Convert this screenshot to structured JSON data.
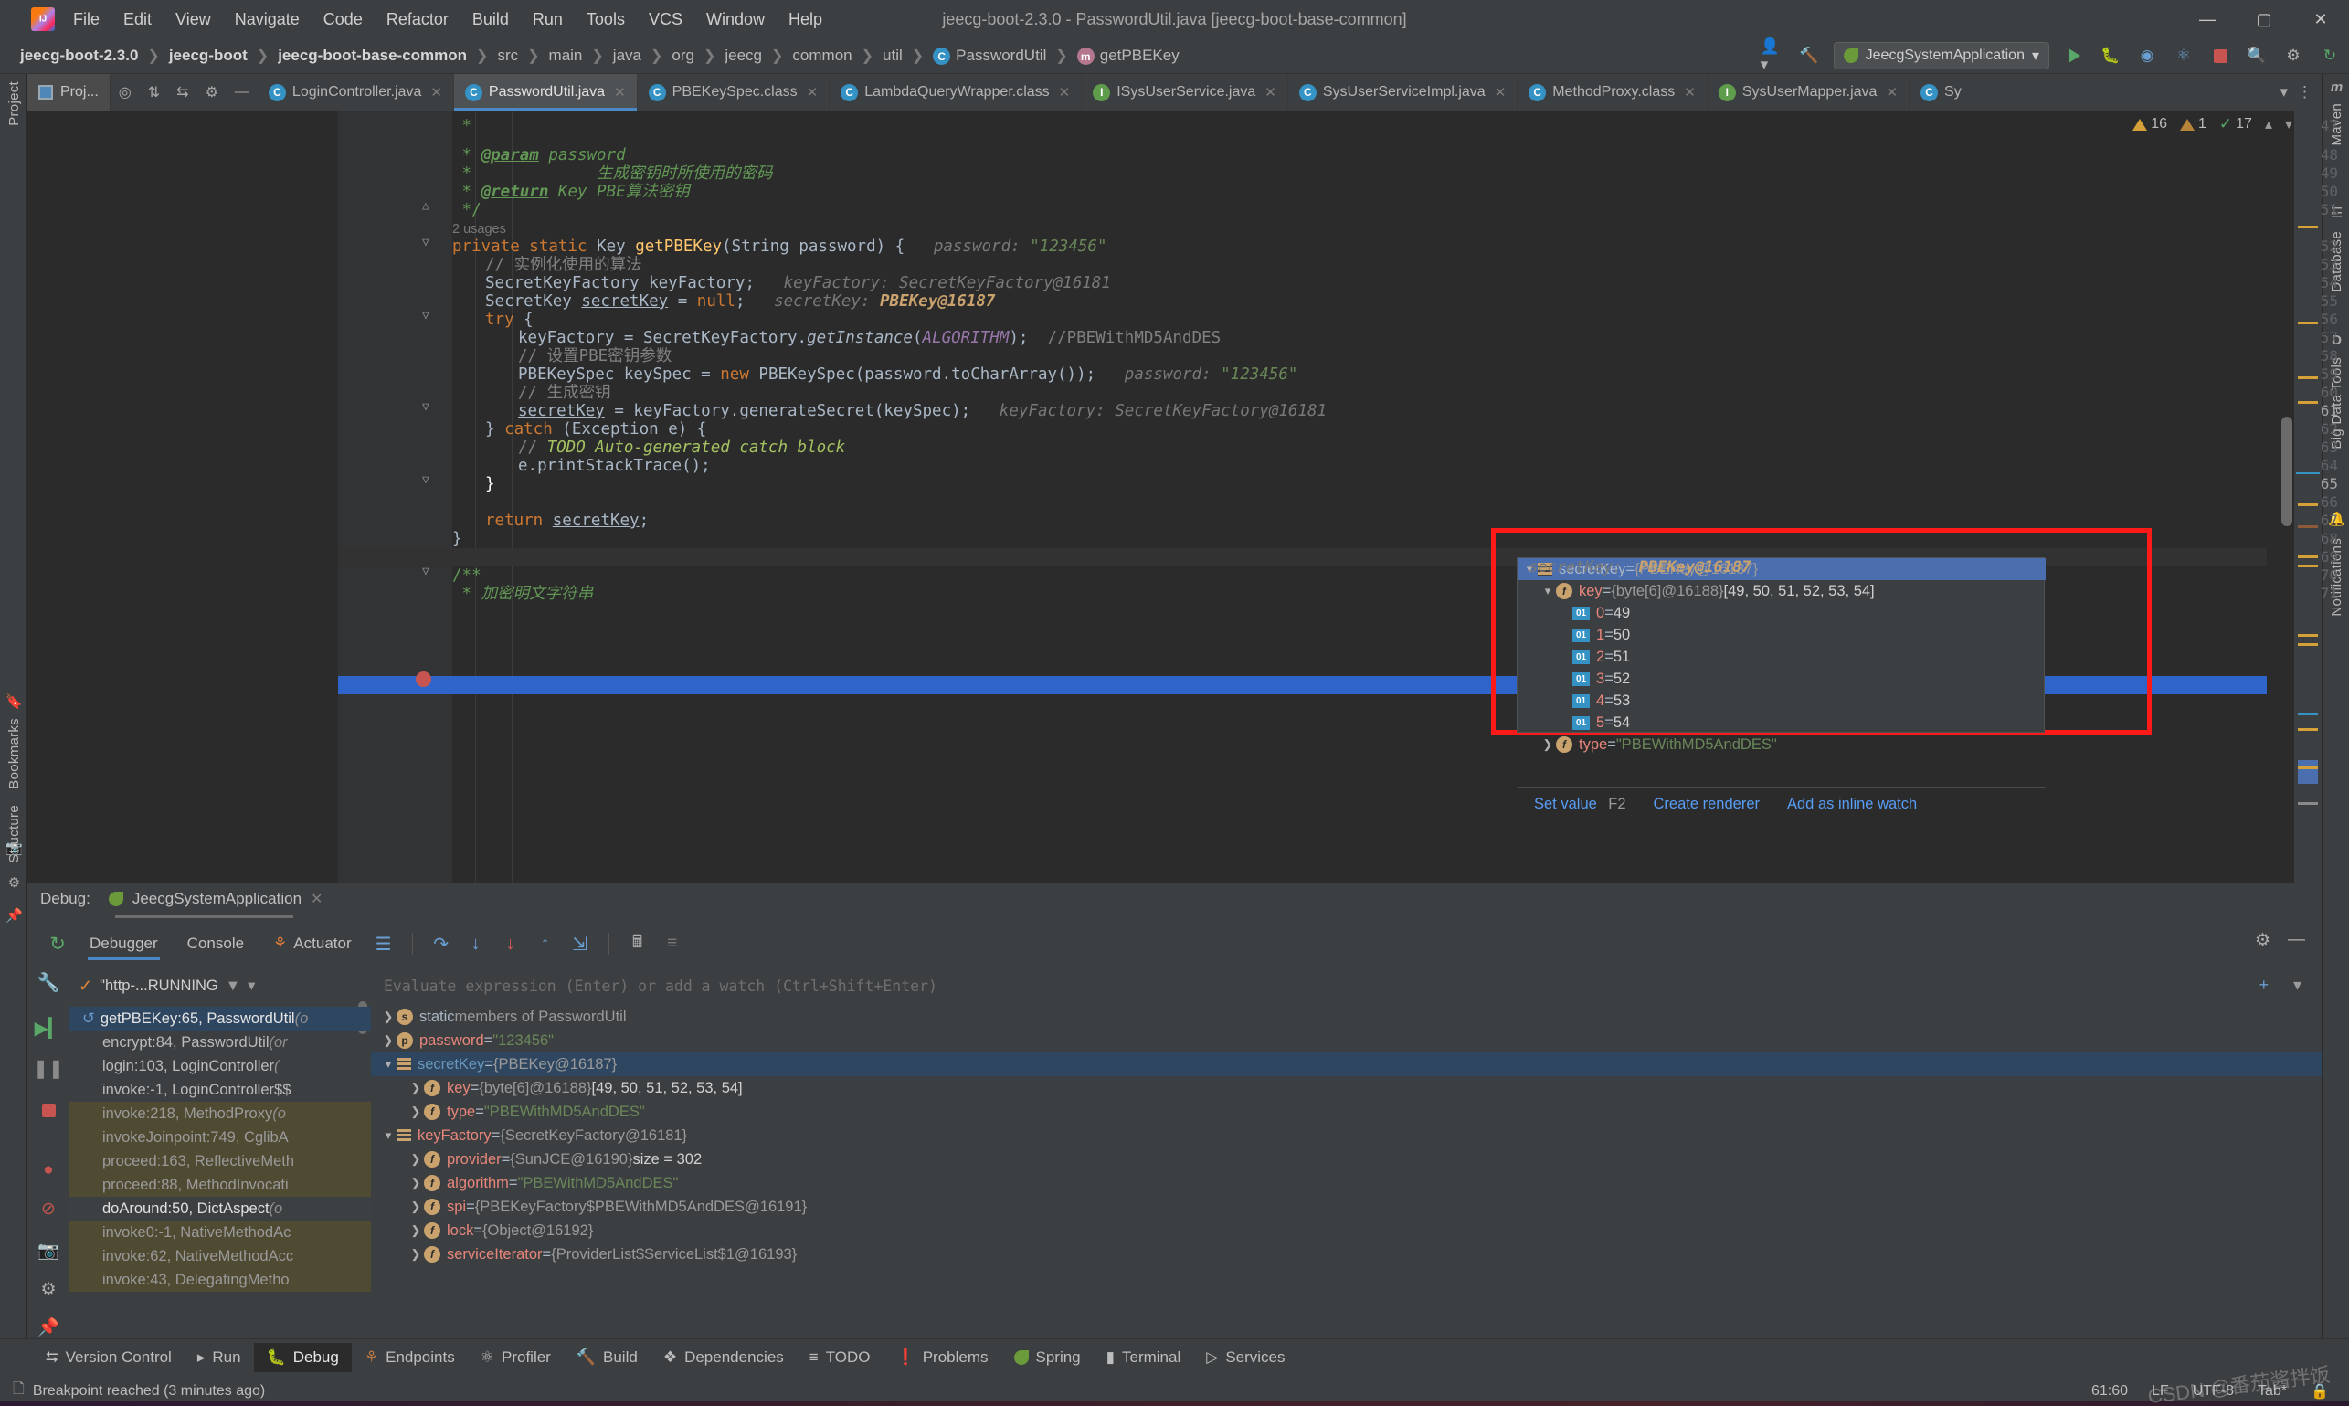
{
  "window": {
    "title": "jeecg-boot-2.3.0 - PasswordUtil.java [jeecg-boot-base-common]",
    "minimize": "—",
    "maximize": "▢",
    "close": "✕"
  },
  "menu": [
    "File",
    "Edit",
    "View",
    "Navigate",
    "Code",
    "Refactor",
    "Build",
    "Run",
    "Tools",
    "VCS",
    "Window",
    "Help"
  ],
  "breadcrumbs": [
    {
      "label": "jeecg-boot-2.3.0",
      "bold": true,
      "icon": ""
    },
    {
      "label": "jeecg-boot",
      "bold": true,
      "icon": ""
    },
    {
      "label": "jeecg-boot-base-common",
      "bold": true,
      "icon": ""
    },
    {
      "label": "src",
      "bold": false,
      "icon": ""
    },
    {
      "label": "main",
      "bold": false,
      "icon": ""
    },
    {
      "label": "java",
      "bold": false,
      "icon": ""
    },
    {
      "label": "org",
      "bold": false,
      "icon": ""
    },
    {
      "label": "jeecg",
      "bold": false,
      "icon": ""
    },
    {
      "label": "common",
      "bold": false,
      "icon": ""
    },
    {
      "label": "util",
      "bold": false,
      "icon": ""
    },
    {
      "label": "PasswordUtil",
      "bold": false,
      "icon": "class-icon"
    },
    {
      "label": "getPBEKey",
      "bold": false,
      "icon": "method-icon"
    }
  ],
  "nav_right": {
    "run_config": "JeecgSystemApplication",
    "icons": [
      "user-icon",
      "hammer-icon",
      "run-icon",
      "debug-icon",
      "coverage-icon",
      "profiler-icon",
      "stop-icon",
      "search-icon",
      "settings-icon",
      "updates-icon"
    ]
  },
  "project_button": "Proj...",
  "editor_tabs": [
    {
      "label": "LoginController.java",
      "icon": "C",
      "kind": "class",
      "active": false
    },
    {
      "label": "PasswordUtil.java",
      "icon": "C",
      "kind": "class",
      "active": true
    },
    {
      "label": "PBEKeySpec.class",
      "icon": "C",
      "kind": "class",
      "active": false
    },
    {
      "label": "LambdaQueryWrapper.class",
      "icon": "C",
      "kind": "class",
      "active": false
    },
    {
      "label": "ISysUserService.java",
      "icon": "I",
      "kind": "interface",
      "active": false
    },
    {
      "label": "SysUserServiceImpl.java",
      "icon": "C",
      "kind": "class",
      "active": false
    },
    {
      "label": "MethodProxy.class",
      "icon": "C",
      "kind": "class",
      "active": false
    },
    {
      "label": "SysUserMapper.java",
      "icon": "I",
      "kind": "interface",
      "active": false
    },
    {
      "label": "Sy",
      "icon": "C",
      "kind": "class",
      "active": false
    }
  ],
  "inspections": {
    "warnings": "16",
    "weak_warnings": "1",
    "typos": "17",
    "warning_icon": "warning-triangle-icon",
    "ok_icon": "checkmark-icon"
  },
  "code": {
    "usages_hint": "2 usages",
    "lines": [
      {
        "n": "47",
        "text": "     *"
      },
      {
        "n": "48",
        "text": "     * @param password"
      },
      {
        "n": "49",
        "text": "     *             生成密钥时所使用的密码"
      },
      {
        "n": "50",
        "text": "     * @return Key PBE算法密钥"
      },
      {
        "n": "51",
        "text": "     */"
      },
      {
        "n": "52",
        "text": "    private static Key getPBEKey(String password) {   password: \"123456\""
      },
      {
        "n": "53",
        "text": "        // 实例化使用的算法"
      },
      {
        "n": "54",
        "text": "        SecretKeyFactory keyFactory;   keyFactory: SecretKeyFactory@16181"
      },
      {
        "n": "55",
        "text": "        SecretKey secretKey = null;   secretKey: PBEKey@16187"
      },
      {
        "n": "56",
        "text": "        try {"
      },
      {
        "n": "57",
        "text": "            keyFactory = SecretKeyFactory.getInstance(ALGORITHM);  //PBEWithMD5AndDES"
      },
      {
        "n": "58",
        "text": "            // 设置PBE密钥参数"
      },
      {
        "n": "59",
        "text": "            PBEKeySpec keySpec = new PBEKeySpec(password.toCharArray());   password: \"123456\""
      },
      {
        "n": "60",
        "text": "            // 生成密钥"
      },
      {
        "n": "61",
        "text": "            secretKey = keyFactory.generateSecret(keySpec);   keyFactory: SecretKeyFactory@16181"
      },
      {
        "n": "62",
        "text": "        } catch (Exception e) {"
      },
      {
        "n": "63",
        "text": "            // TODO Auto-generated catch block"
      },
      {
        "n": "64",
        "text": "            e.printStackTrace();"
      },
      {
        "n": "65",
        "text": "        }"
      },
      {
        "n": "66",
        "text": ""
      },
      {
        "n": "67",
        "text": "        return secretKey;"
      },
      {
        "n": "68",
        "text": "    }"
      },
      {
        "n": "69",
        "text": ""
      },
      {
        "n": "70",
        "text": "    /**"
      },
      {
        "n": "71",
        "text": "     * 加密明文字符串"
      }
    ]
  },
  "popup": {
    "expression_label": "secretKey:",
    "expression_value": "PBEKey@16187",
    "rows": [
      {
        "indent": 0,
        "chev": "v",
        "icon": "object-icon",
        "name": "secretKey",
        "eq": " = ",
        "value": "{PBEKey@16187}",
        "selected": true,
        "value_kind": "ref"
      },
      {
        "indent": 1,
        "chev": "v",
        "icon": "field-icon",
        "name": "key",
        "eq": " = ",
        "value": "{byte[6]@16188}",
        "extra": " [49, 50, 51, 52, 53, 54]",
        "selected": false,
        "value_kind": "ref"
      },
      {
        "indent": 2,
        "chev": "",
        "icon": "byte-icon",
        "name": "0",
        "eq": " = ",
        "value": "49",
        "selected": false,
        "value_kind": "num"
      },
      {
        "indent": 2,
        "chev": "",
        "icon": "byte-icon",
        "name": "1",
        "eq": " = ",
        "value": "50",
        "selected": false,
        "value_kind": "num"
      },
      {
        "indent": 2,
        "chev": "",
        "icon": "byte-icon",
        "name": "2",
        "eq": " = ",
        "value": "51",
        "selected": false,
        "value_kind": "num"
      },
      {
        "indent": 2,
        "chev": "",
        "icon": "byte-icon",
        "name": "3",
        "eq": " = ",
        "value": "52",
        "selected": false,
        "value_kind": "num"
      },
      {
        "indent": 2,
        "chev": "",
        "icon": "byte-icon",
        "name": "4",
        "eq": " = ",
        "value": "53",
        "selected": false,
        "value_kind": "num"
      },
      {
        "indent": 2,
        "chev": "",
        "icon": "byte-icon",
        "name": "5",
        "eq": " = ",
        "value": "54",
        "selected": false,
        "value_kind": "num"
      },
      {
        "indent": 1,
        "chev": ">",
        "icon": "field-icon",
        "name": "type",
        "eq": " = ",
        "value": "\"PBEWithMD5AndDES\"",
        "selected": false,
        "value_kind": "str"
      }
    ],
    "actions": [
      {
        "label": "Set value",
        "key": "F2"
      },
      {
        "label": "Create renderer",
        "key": ""
      },
      {
        "label": "Add as inline watch",
        "key": ""
      }
    ]
  },
  "debug_window": {
    "title_label": "Debug:",
    "session": "JeecgSystemApplication",
    "tabs": [
      {
        "label": "Debugger",
        "active": true,
        "icon": ""
      },
      {
        "label": "Console",
        "active": false,
        "icon": ""
      },
      {
        "label": "Actuator",
        "active": false,
        "icon": "actuator-icon"
      }
    ],
    "thread_selector": "\"http-...RUNNING",
    "frames": [
      {
        "label": "getPBEKey:65, PasswordUtil",
        "suffix": " (o",
        "state": "selected"
      },
      {
        "label": "encrypt:84, PasswordUtil",
        "suffix": " (or",
        "state": "normal"
      },
      {
        "label": "login:103, LoginController",
        "suffix": " (",
        "state": "normal"
      },
      {
        "label": "invoke:-1, LoginController$$",
        "suffix": "",
        "state": "normal"
      },
      {
        "label": "invoke:218, MethodProxy",
        "suffix": " (o",
        "state": "lib"
      },
      {
        "label": "invokeJoinpoint:749, CglibA",
        "suffix": "",
        "state": "lib"
      },
      {
        "label": "proceed:163, ReflectiveMeth",
        "suffix": "",
        "state": "lib"
      },
      {
        "label": "proceed:88, MethodInvocati",
        "suffix": "",
        "state": "lib"
      },
      {
        "label": "doAround:50, DictAspect",
        "suffix": " (o",
        "state": "libsel"
      },
      {
        "label": "invoke0:-1, NativeMethodAc",
        "suffix": "",
        "state": "lib"
      },
      {
        "label": "invoke:62, NativeMethodAcc",
        "suffix": "",
        "state": "lib"
      },
      {
        "label": "invoke:43, DelegatingMetho",
        "suffix": "",
        "state": "lib"
      }
    ],
    "evaluate_placeholder": "Evaluate expression (Enter) or add a watch (Ctrl+Shift+Enter)",
    "variables": [
      {
        "indent": 0,
        "chev": ">",
        "icon": "static-icon",
        "name": "static",
        "name_kind": "plain",
        "rest": " members of PasswordUtil",
        "eq": "",
        "value": "",
        "value_kind": "",
        "selected": false
      },
      {
        "indent": 0,
        "chev": ">",
        "icon": "param-icon",
        "name": "password",
        "name_kind": "red",
        "eq": " = ",
        "value": "\"123456\"",
        "value_kind": "str",
        "selected": false
      },
      {
        "indent": 0,
        "chev": "v",
        "icon": "object-icon",
        "name": "secretKey",
        "name_kind": "blue",
        "eq": " = ",
        "value": "{PBEKey@16187}",
        "value_kind": "ref",
        "selected": true
      },
      {
        "indent": 1,
        "chev": ">",
        "icon": "field-icon",
        "name": "key",
        "name_kind": "red",
        "eq": " = ",
        "value": "{byte[6]@16188}",
        "extra": " [49, 50, 51, 52, 53, 54]",
        "value_kind": "ref",
        "selected": false
      },
      {
        "indent": 1,
        "chev": ">",
        "icon": "field-icon",
        "name": "type",
        "name_kind": "red",
        "eq": " = ",
        "value": "\"PBEWithMD5AndDES\"",
        "value_kind": "str",
        "selected": false
      },
      {
        "indent": 0,
        "chev": "v",
        "icon": "object-icon",
        "name": "keyFactory",
        "name_kind": "red",
        "eq": " = ",
        "value": "{SecretKeyFactory@16181}",
        "value_kind": "ref",
        "selected": false
      },
      {
        "indent": 1,
        "chev": ">",
        "icon": "field-icon",
        "name": "provider",
        "name_kind": "red",
        "eq": " = ",
        "value": "{SunJCE@16190}",
        "extra": "  size = 302",
        "value_kind": "ref",
        "selected": false
      },
      {
        "indent": 1,
        "chev": ">",
        "icon": "field-icon",
        "name": "algorithm",
        "name_kind": "red",
        "eq": " = ",
        "value": "\"PBEWithMD5AndDES\"",
        "value_kind": "str",
        "selected": false
      },
      {
        "indent": 1,
        "chev": ">",
        "icon": "field-icon",
        "name": "spi",
        "name_kind": "red",
        "eq": " = ",
        "value": "{PBEKeyFactory$PBEWithMD5AndDES@16191}",
        "value_kind": "ref",
        "selected": false
      },
      {
        "indent": 1,
        "chev": ">",
        "icon": "field-icon",
        "name": "lock",
        "name_kind": "red",
        "eq": " = ",
        "value": "{Object@16192}",
        "value_kind": "ref",
        "selected": false
      },
      {
        "indent": 1,
        "chev": ">",
        "icon": "field-icon",
        "name": "serviceIterator",
        "name_kind": "red",
        "eq": " = ",
        "value": "{ProviderList$ServiceList$1@16193}",
        "value_kind": "ref",
        "selected": false
      }
    ]
  },
  "bottom_tools": [
    {
      "label": "Version Control",
      "icon": "branch-icon",
      "active": false
    },
    {
      "label": "Run",
      "icon": "play-icon",
      "active": false
    },
    {
      "label": "Debug",
      "icon": "bug-icon",
      "active": true
    },
    {
      "label": "Endpoints",
      "icon": "endpoints-icon",
      "active": false
    },
    {
      "label": "Profiler",
      "icon": "profiler-icon",
      "active": false
    },
    {
      "label": "Build",
      "icon": "hammer-icon",
      "active": false
    },
    {
      "label": "Dependencies",
      "icon": "layers-icon",
      "active": false
    },
    {
      "label": "TODO",
      "icon": "list-icon",
      "active": false
    },
    {
      "label": "Problems",
      "icon": "exclamation-icon",
      "active": false
    },
    {
      "label": "Spring",
      "icon": "leaf-icon",
      "active": false
    },
    {
      "label": "Terminal",
      "icon": "terminal-icon",
      "active": false
    },
    {
      "label": "Services",
      "icon": "services-icon",
      "active": false
    }
  ],
  "status": {
    "message": "Breakpoint reached (3 minutes ago)",
    "caret": "61:60",
    "line_sep": "LF",
    "encoding": "UTF-8",
    "indent": "Tab*",
    "watermark": "CSDN @番茄酱拌饭"
  },
  "left_strip": [
    "Project",
    "Bookmarks",
    "Structure"
  ],
  "right_strip": [
    "Maven",
    "Database",
    "Big Data Tools",
    "Notifications"
  ],
  "colors": {
    "accent": "#4a88c7",
    "selection": "#2f65ca",
    "popup_outline": "#ff1a1a",
    "keyword": "#cc7832",
    "string": "#6a8759",
    "comment": "#808080",
    "javadoc": "#629755",
    "method": "#ffc66d"
  }
}
